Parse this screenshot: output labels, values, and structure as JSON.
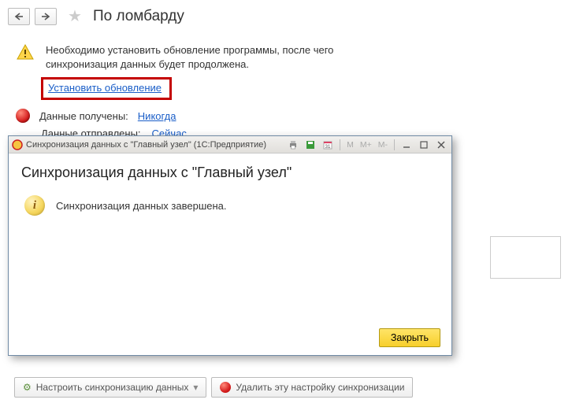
{
  "page": {
    "title": "По ломбарду"
  },
  "warning": {
    "text": "Необходимо установить обновление программы, после чего синхронизация данных будет продолжена."
  },
  "links": {
    "install_update": "Установить обновление"
  },
  "status": {
    "received_label": "Данные получены:",
    "received_value": "Никогда",
    "sent_label": "Данные отправлены:",
    "sent_value": "Сейчас"
  },
  "bottom": {
    "configure": "Настроить синхронизацию данных",
    "delete": "Удалить эту настройку синхронизации"
  },
  "modal": {
    "window_title": "Синхронизация данных с \"Главный узел\"  (1С:Предприятие)",
    "heading": "Синхронизация данных с \"Главный узел\"",
    "message": "Синхронизация данных завершена.",
    "close": "Закрыть",
    "titlebuttons": {
      "m": "M",
      "mplus": "M+",
      "mminus": "M-"
    }
  }
}
